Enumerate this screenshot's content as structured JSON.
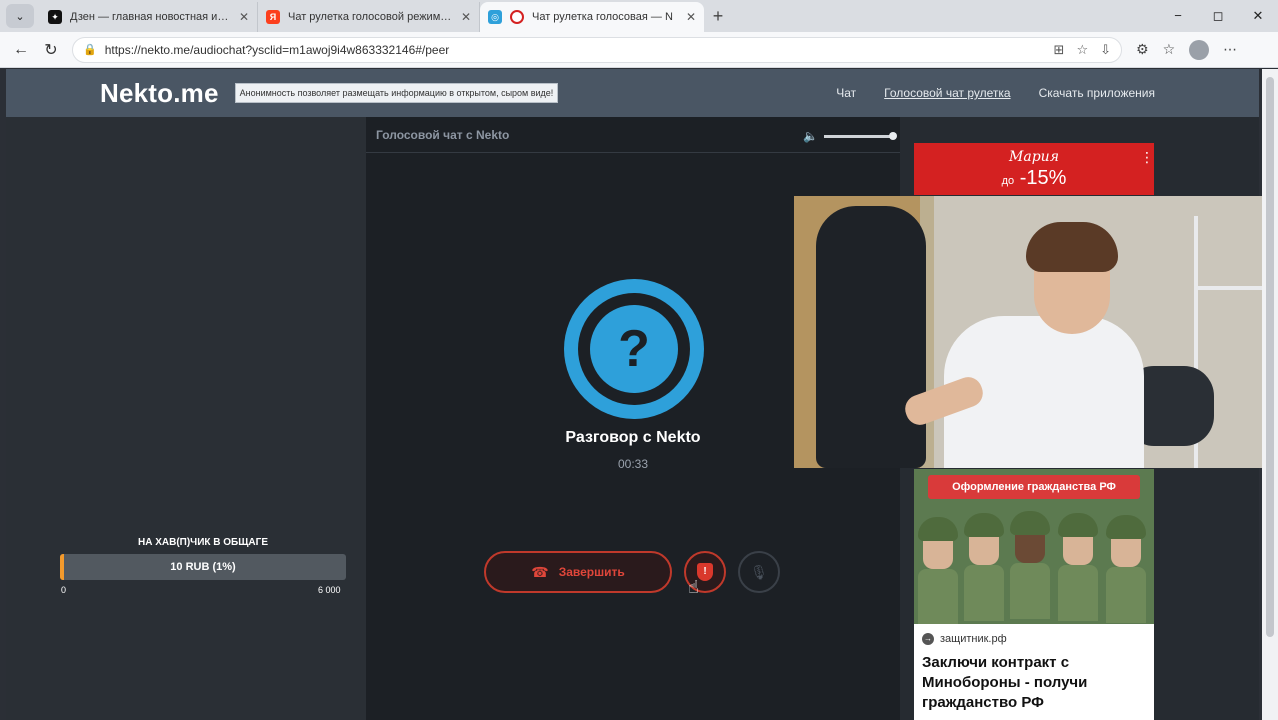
{
  "browser": {
    "tabs": [
      {
        "title": "Дзен — главная новостная инфо",
        "favicon": "dzen"
      },
      {
        "title": "Чат рулетка голосовой режим —",
        "favicon": "yandex"
      },
      {
        "title": "Чат рулетка голосовая — N",
        "favicon": "nekto"
      }
    ],
    "url": "https://nekto.me/audiochat?ysclid=m1awoj9i4w863332146#/peer",
    "new_tab": "+",
    "window_controls": [
      "−",
      "◻",
      "✕"
    ]
  },
  "site": {
    "logo": "Nekto.me",
    "notice": "Анонимность позволяет размещать информацию в открытом, сыром виде!",
    "nav": [
      "Чат",
      "Голосовой чат рулетка",
      "Скачать приложения"
    ]
  },
  "goal": {
    "title": "НА ХАВ(П)ЧИК В ОБЩАГЕ",
    "amount": "10 RUB (1%)",
    "progress": 0.01,
    "min": "0",
    "max": "6 000"
  },
  "call": {
    "header": "Голосовой чат с Nekto",
    "title": "Разговор с Nekto",
    "timer": "00:33",
    "end_label": "Завершить"
  },
  "ads": {
    "top": {
      "brand": "Мария",
      "discount_prefix": "до",
      "discount": "-15%"
    },
    "bottom": {
      "banner": "Оформление гражданства РФ",
      "source": "защитник.рф",
      "headline": "Заключи контракт с Минобороны - получи гражданство РФ"
    }
  },
  "colors": {
    "accent": "#2ea0da",
    "danger": "#c0392b",
    "goal_fill": "#f39a2c"
  }
}
